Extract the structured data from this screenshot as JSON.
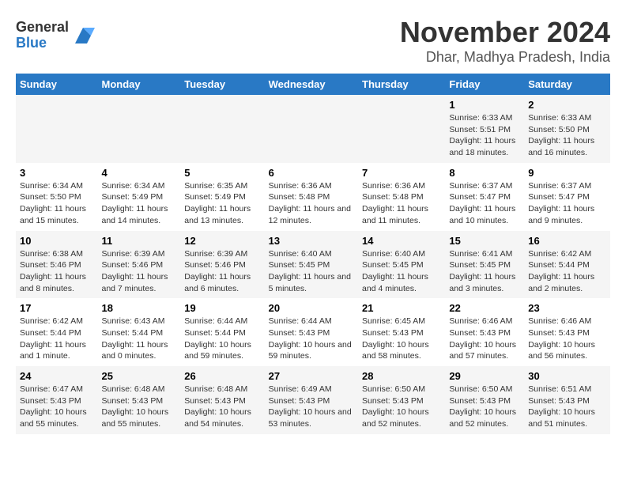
{
  "logo": {
    "general": "General",
    "blue": "Blue"
  },
  "title": "November 2024",
  "location": "Dhar, Madhya Pradesh, India",
  "days_of_week": [
    "Sunday",
    "Monday",
    "Tuesday",
    "Wednesday",
    "Thursday",
    "Friday",
    "Saturday"
  ],
  "weeks": [
    [
      {
        "day": "",
        "info": ""
      },
      {
        "day": "",
        "info": ""
      },
      {
        "day": "",
        "info": ""
      },
      {
        "day": "",
        "info": ""
      },
      {
        "day": "",
        "info": ""
      },
      {
        "day": "1",
        "info": "Sunrise: 6:33 AM\nSunset: 5:51 PM\nDaylight: 11 hours and 18 minutes."
      },
      {
        "day": "2",
        "info": "Sunrise: 6:33 AM\nSunset: 5:50 PM\nDaylight: 11 hours and 16 minutes."
      }
    ],
    [
      {
        "day": "3",
        "info": "Sunrise: 6:34 AM\nSunset: 5:50 PM\nDaylight: 11 hours and 15 minutes."
      },
      {
        "day": "4",
        "info": "Sunrise: 6:34 AM\nSunset: 5:49 PM\nDaylight: 11 hours and 14 minutes."
      },
      {
        "day": "5",
        "info": "Sunrise: 6:35 AM\nSunset: 5:49 PM\nDaylight: 11 hours and 13 minutes."
      },
      {
        "day": "6",
        "info": "Sunrise: 6:36 AM\nSunset: 5:48 PM\nDaylight: 11 hours and 12 minutes."
      },
      {
        "day": "7",
        "info": "Sunrise: 6:36 AM\nSunset: 5:48 PM\nDaylight: 11 hours and 11 minutes."
      },
      {
        "day": "8",
        "info": "Sunrise: 6:37 AM\nSunset: 5:47 PM\nDaylight: 11 hours and 10 minutes."
      },
      {
        "day": "9",
        "info": "Sunrise: 6:37 AM\nSunset: 5:47 PM\nDaylight: 11 hours and 9 minutes."
      }
    ],
    [
      {
        "day": "10",
        "info": "Sunrise: 6:38 AM\nSunset: 5:46 PM\nDaylight: 11 hours and 8 minutes."
      },
      {
        "day": "11",
        "info": "Sunrise: 6:39 AM\nSunset: 5:46 PM\nDaylight: 11 hours and 7 minutes."
      },
      {
        "day": "12",
        "info": "Sunrise: 6:39 AM\nSunset: 5:46 PM\nDaylight: 11 hours and 6 minutes."
      },
      {
        "day": "13",
        "info": "Sunrise: 6:40 AM\nSunset: 5:45 PM\nDaylight: 11 hours and 5 minutes."
      },
      {
        "day": "14",
        "info": "Sunrise: 6:40 AM\nSunset: 5:45 PM\nDaylight: 11 hours and 4 minutes."
      },
      {
        "day": "15",
        "info": "Sunrise: 6:41 AM\nSunset: 5:45 PM\nDaylight: 11 hours and 3 minutes."
      },
      {
        "day": "16",
        "info": "Sunrise: 6:42 AM\nSunset: 5:44 PM\nDaylight: 11 hours and 2 minutes."
      }
    ],
    [
      {
        "day": "17",
        "info": "Sunrise: 6:42 AM\nSunset: 5:44 PM\nDaylight: 11 hours and 1 minute."
      },
      {
        "day": "18",
        "info": "Sunrise: 6:43 AM\nSunset: 5:44 PM\nDaylight: 11 hours and 0 minutes."
      },
      {
        "day": "19",
        "info": "Sunrise: 6:44 AM\nSunset: 5:44 PM\nDaylight: 10 hours and 59 minutes."
      },
      {
        "day": "20",
        "info": "Sunrise: 6:44 AM\nSunset: 5:43 PM\nDaylight: 10 hours and 59 minutes."
      },
      {
        "day": "21",
        "info": "Sunrise: 6:45 AM\nSunset: 5:43 PM\nDaylight: 10 hours and 58 minutes."
      },
      {
        "day": "22",
        "info": "Sunrise: 6:46 AM\nSunset: 5:43 PM\nDaylight: 10 hours and 57 minutes."
      },
      {
        "day": "23",
        "info": "Sunrise: 6:46 AM\nSunset: 5:43 PM\nDaylight: 10 hours and 56 minutes."
      }
    ],
    [
      {
        "day": "24",
        "info": "Sunrise: 6:47 AM\nSunset: 5:43 PM\nDaylight: 10 hours and 55 minutes."
      },
      {
        "day": "25",
        "info": "Sunrise: 6:48 AM\nSunset: 5:43 PM\nDaylight: 10 hours and 55 minutes."
      },
      {
        "day": "26",
        "info": "Sunrise: 6:48 AM\nSunset: 5:43 PM\nDaylight: 10 hours and 54 minutes."
      },
      {
        "day": "27",
        "info": "Sunrise: 6:49 AM\nSunset: 5:43 PM\nDaylight: 10 hours and 53 minutes."
      },
      {
        "day": "28",
        "info": "Sunrise: 6:50 AM\nSunset: 5:43 PM\nDaylight: 10 hours and 52 minutes."
      },
      {
        "day": "29",
        "info": "Sunrise: 6:50 AM\nSunset: 5:43 PM\nDaylight: 10 hours and 52 minutes."
      },
      {
        "day": "30",
        "info": "Sunrise: 6:51 AM\nSunset: 5:43 PM\nDaylight: 10 hours and 51 minutes."
      }
    ]
  ]
}
